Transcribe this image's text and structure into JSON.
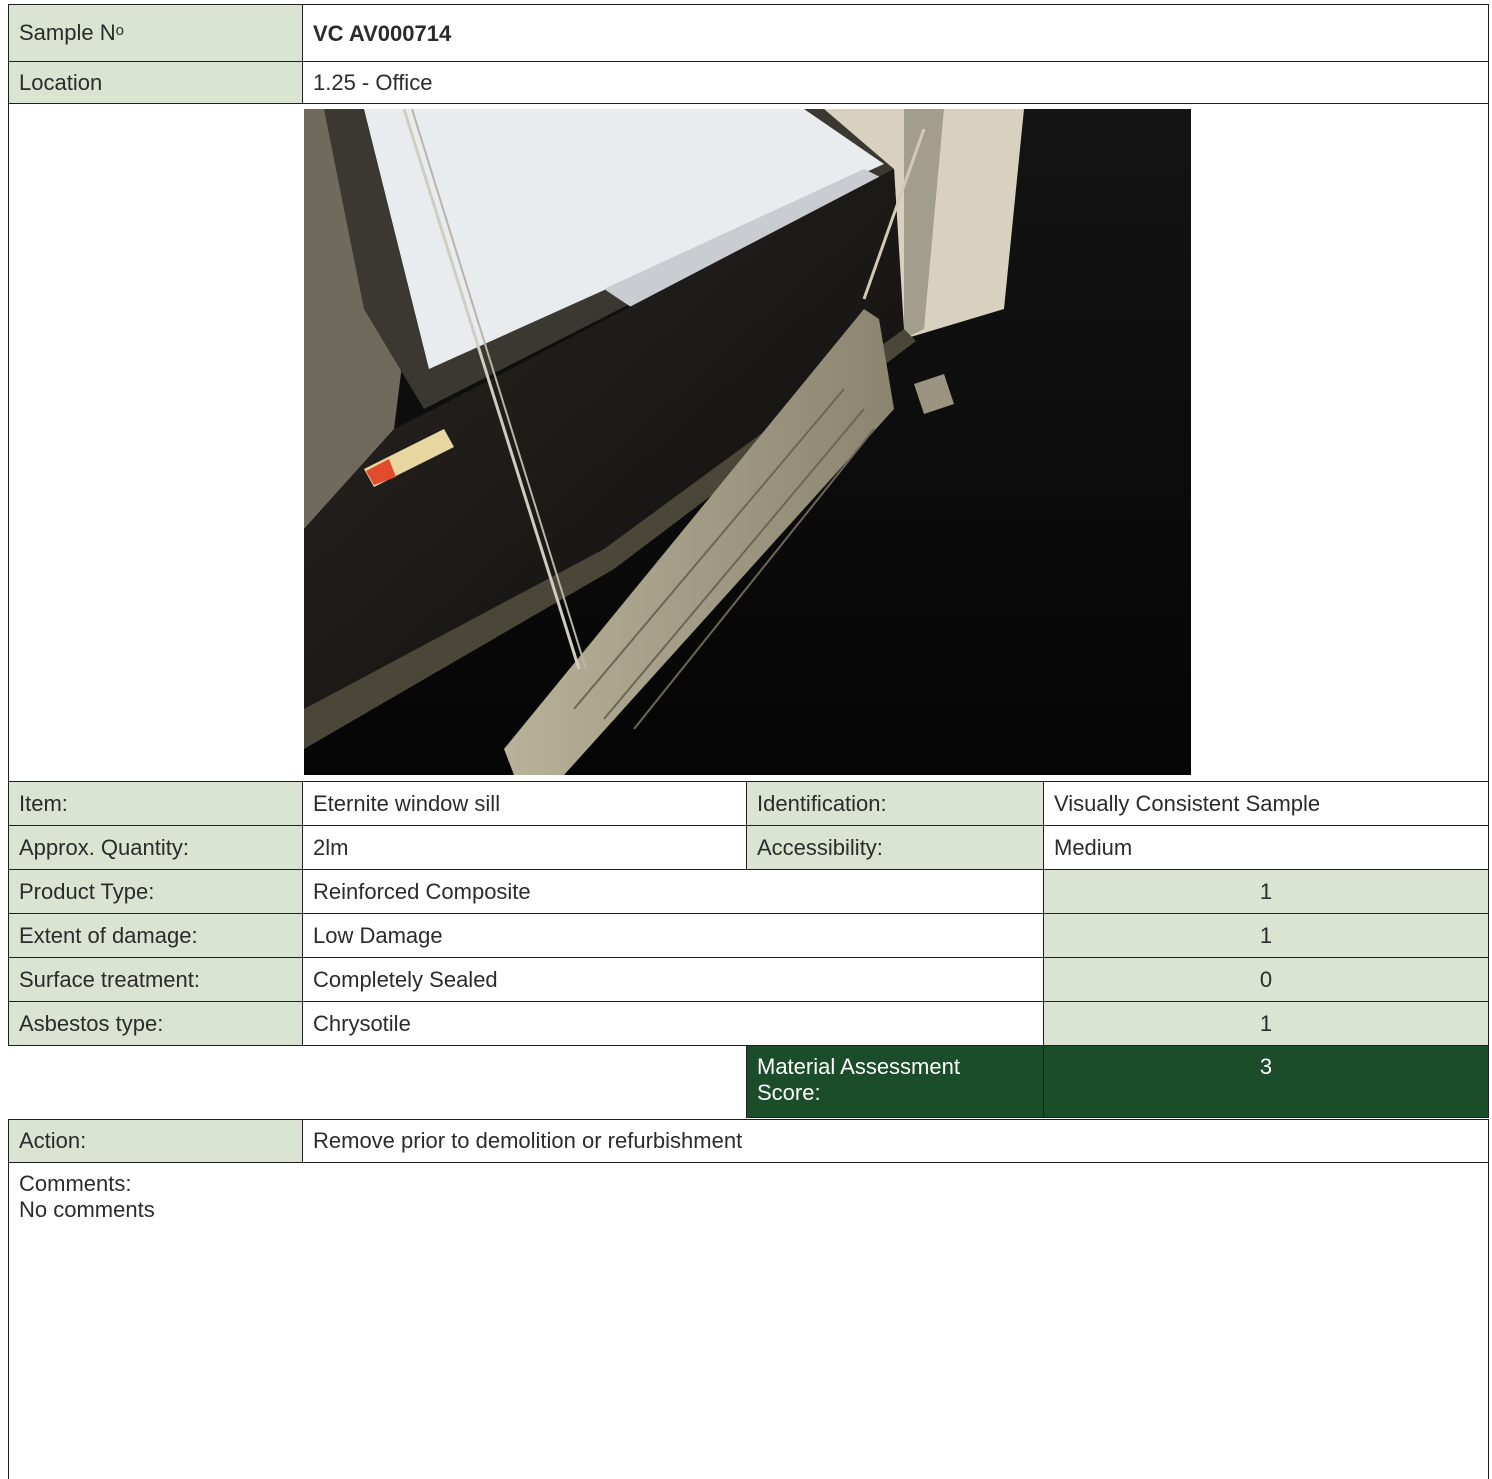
{
  "sample": {
    "label": "Sample N",
    "label_sup": "o",
    "value": "VC AV000714"
  },
  "location": {
    "label": "Location",
    "value": "1.25 - Office"
  },
  "photo": {
    "description_icon": "photo-window-sill-radiator"
  },
  "item": {
    "label": "Item:",
    "value": "Eternite window sill",
    "id_label": "Identification:",
    "id_value": "Visually Consistent Sample"
  },
  "quantity": {
    "label": "Approx. Quantity:",
    "value": "2lm",
    "access_label": "Accessibility:",
    "access_value": "Medium"
  },
  "assessment": [
    {
      "label": "Product Type:",
      "value": "Reinforced Composite",
      "score": "1"
    },
    {
      "label": "Extent of damage:",
      "value": "Low Damage",
      "score": "1"
    },
    {
      "label": "Surface treatment:",
      "value": "Completely Sealed",
      "score": "0"
    },
    {
      "label": "Asbestos type:",
      "value": "Chrysotile",
      "score": "1"
    }
  ],
  "total": {
    "label": "Material Assessment Score:",
    "value": "3"
  },
  "action": {
    "label": "Action:",
    "value": "Remove prior to demolition or refurbishment"
  },
  "comments": {
    "label": "Comments:",
    "value": "No comments"
  },
  "colors": {
    "label_bg": "#dbe3d3",
    "score_dark": "#1b4d2a",
    "border": "#1e1e1e"
  }
}
